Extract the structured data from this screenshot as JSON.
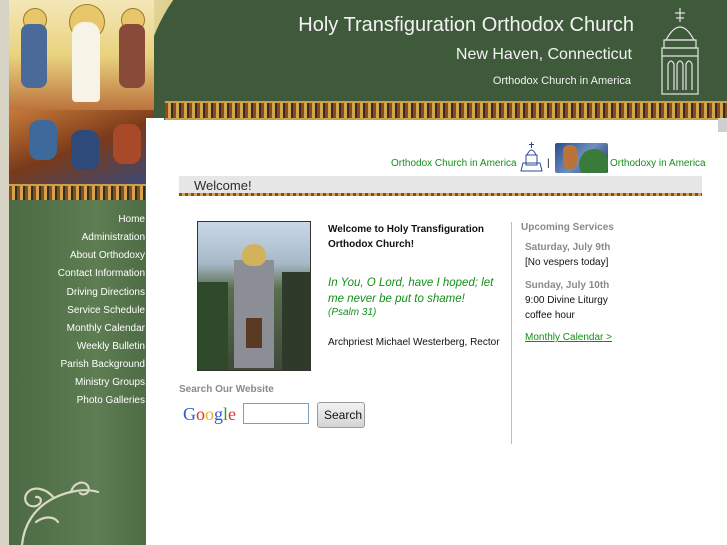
{
  "header": {
    "title": "Holy Transfiguration Orthodox Church",
    "subtitle": "New Haven, Connecticut",
    "tagline": "Orthodox Church in America"
  },
  "sidebar": {
    "items": [
      {
        "label": "Home"
      },
      {
        "label": "Administration"
      },
      {
        "label": "About Orthodoxy"
      },
      {
        "label": "Contact Information"
      },
      {
        "label": "Driving Directions"
      },
      {
        "label": "Service Schedule"
      },
      {
        "label": "Monthly Calendar"
      },
      {
        "label": "Weekly Bulletin"
      },
      {
        "label": "Parish Background"
      },
      {
        "label": "Ministry Groups"
      },
      {
        "label": "Photo Galleries"
      }
    ]
  },
  "top_links": {
    "oca": "Orthodox Church in America",
    "separator": "|",
    "orthodoxy": "Orthodoxy in America"
  },
  "main": {
    "welcome_title": "Welcome!",
    "welcome_heading": "Welcome to Holy Transfiguration Orthodox Church!",
    "psalm": "In You, O Lord, have I hoped; let me never be put to shame!",
    "psalm_ref": "(Psalm 31)",
    "rector": "Archpriest Michael Westerberg, Rector"
  },
  "services": {
    "heading": "Upcoming Services",
    "days": [
      {
        "day": "Saturday, July 9th",
        "lines": [
          "[No vespers today]"
        ]
      },
      {
        "day": "Sunday, July 10th",
        "lines": [
          "9:00 Divine Liturgy",
          "coffee hour"
        ]
      }
    ],
    "calendar_link": "Monthly Calendar >"
  },
  "search": {
    "label": "Search Our Website",
    "input_value": "",
    "button_label": "Search",
    "logo_text": "Google"
  },
  "colors": {
    "header_green": "#3f5a3b",
    "link_green": "#138f18",
    "sidebar_green": "#5f7d53",
    "gold": "#d3a44a"
  }
}
